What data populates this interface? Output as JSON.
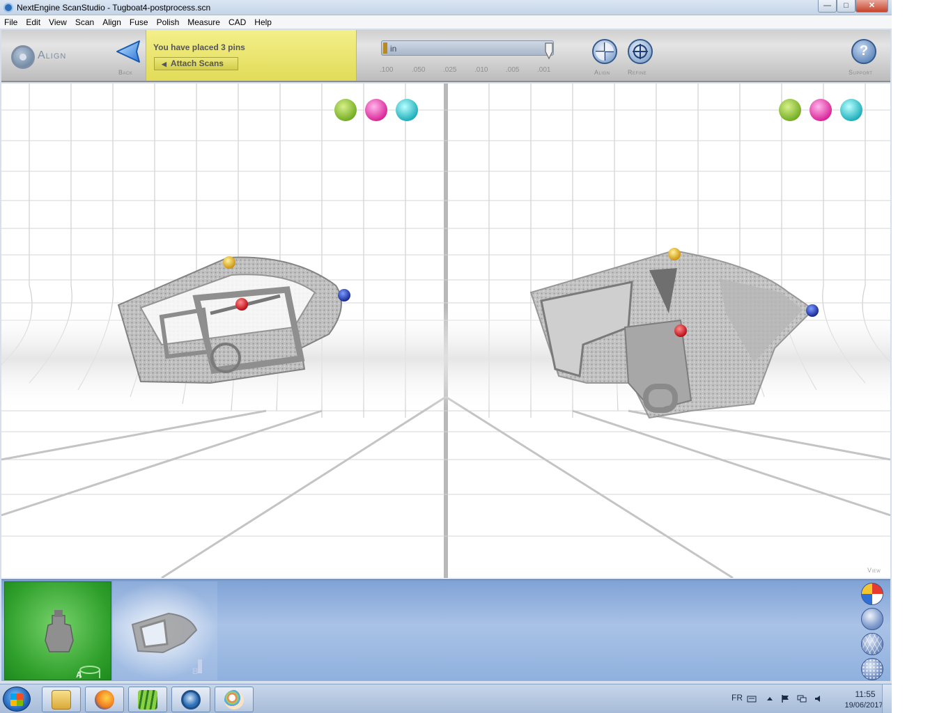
{
  "window": {
    "title": "NextEngine ScanStudio - Tugboat4-postprocess.scn",
    "minimize_glyph": "—",
    "maximize_glyph": "□",
    "close_glyph": "✕"
  },
  "menu": [
    "File",
    "Edit",
    "View",
    "Scan",
    "Align",
    "Fuse",
    "Polish",
    "Measure",
    "CAD",
    "Help"
  ],
  "toolbar": {
    "mode_label": "Align",
    "back_label": "Back",
    "pin_status": "You have placed 3 pins",
    "attach_label": "Attach Scans",
    "units_value": "in",
    "units_level": 0.98,
    "tolerances": [
      ".100",
      ".050",
      ".025",
      ".010",
      ".005",
      ".001"
    ],
    "align_label": "Align",
    "refine_label": "Refine",
    "support_label": "Support",
    "support_glyph": "?"
  },
  "viewport": {
    "view_label": "View",
    "pin_palette_colors": [
      "#8fc72a",
      "#ee3ab8",
      "#23c9d0"
    ],
    "pin_colors": {
      "yellow": "#e9b50b",
      "red": "#d9161c",
      "blue": "#1638b8"
    }
  },
  "scan_strip": {
    "scan_a_label": "A",
    "scan_b_label": "B",
    "render_modes": [
      "color",
      "shaded",
      "mesh",
      "points"
    ]
  },
  "taskbar": {
    "apps": [
      "windows-explorer",
      "firefox",
      "green-app",
      "scanstudio",
      "paint"
    ],
    "language": "FR",
    "time": "11:55",
    "date": "19/06/2017"
  }
}
